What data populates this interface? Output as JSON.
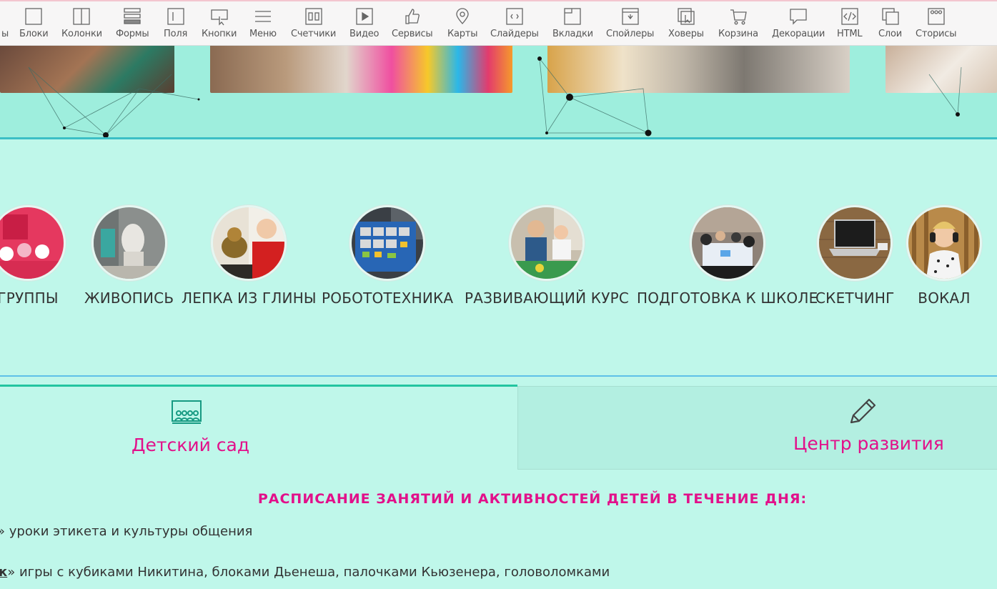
{
  "toolbar": {
    "items": [
      {
        "label": "ы",
        "icon": "partial-icon"
      },
      {
        "label": "Блоки",
        "icon": "square-icon"
      },
      {
        "label": "Колонки",
        "icon": "columns-icon"
      },
      {
        "label": "Формы",
        "icon": "forms-icon"
      },
      {
        "label": "Поля",
        "icon": "field-icon"
      },
      {
        "label": "Кнопки",
        "icon": "button-cursor-icon"
      },
      {
        "label": "Меню",
        "icon": "menu-icon"
      },
      {
        "label": "Счетчики",
        "icon": "counter-icon"
      },
      {
        "label": "Видео",
        "icon": "video-icon"
      },
      {
        "label": "Сервисы",
        "icon": "thumbs-up-icon"
      },
      {
        "label": "Карты",
        "icon": "map-pin-icon"
      },
      {
        "label": "Слайдеры",
        "icon": "slider-icon"
      },
      {
        "label": "Вкладки",
        "icon": "tabs-icon"
      },
      {
        "label": "Спойлеры",
        "icon": "spoiler-icon"
      },
      {
        "label": "Ховеры",
        "icon": "hover-icon"
      },
      {
        "label": "Корзина",
        "icon": "cart-icon"
      },
      {
        "label": "Декорации",
        "icon": "speech-bubble-icon"
      },
      {
        "label": "HTML",
        "icon": "code-icon"
      },
      {
        "label": "Слои",
        "icon": "layers-icon"
      },
      {
        "label": "Сторисы",
        "icon": "stories-icon"
      }
    ]
  },
  "courses": [
    {
      "label": "ГРУППЫ"
    },
    {
      "label": "ЖИВОПИСЬ"
    },
    {
      "label": "ЛЕПКА ИЗ ГЛИНЫ"
    },
    {
      "label": "РОБОТОТЕХНИКА"
    },
    {
      "label": "РАЗВИВАЮЩИЙ КУРС"
    },
    {
      "label": "ПОДГОТОВКА К ШКОЛЕ"
    },
    {
      "label": "СКЕТЧИНГ"
    },
    {
      "label": "ВОКАЛ"
    }
  ],
  "tabs": {
    "left": {
      "title": "Детский сад",
      "icon": "classroom-icon"
    },
    "right": {
      "title": "Центр развития",
      "icon": "pencil-icon"
    }
  },
  "schedule": {
    "title": "Расписание занятий и активностей детей в течение дня:",
    "lines": [
      {
        "prefix": "»",
        "text": " уроки этикета и культуры общения"
      },
      {
        "prefix": "к",
        "suffix": "»",
        "text": " игры с кубиками Никитина, блоками Дьенеша, палочками Кьюзенера, головоломками"
      }
    ]
  },
  "colors": {
    "accent": "#e2108a",
    "background": "#bff7ea",
    "tab_border": "#22c5a0"
  }
}
